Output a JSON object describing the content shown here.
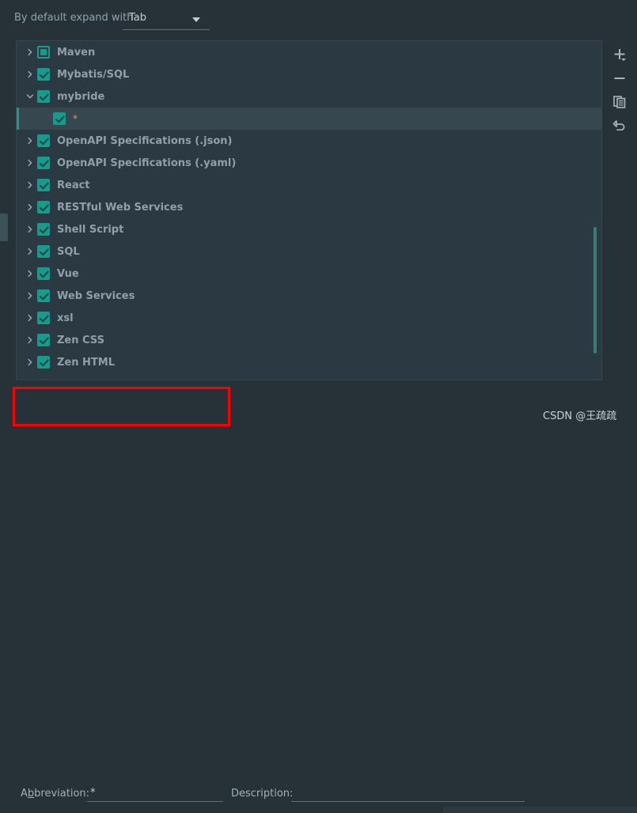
{
  "header": {
    "label": "By default expand with",
    "expand_with": {
      "selected": "Tab",
      "arrow_icon": "chevron-down-icon"
    }
  },
  "tree": {
    "rows": [
      {
        "label": "Maven",
        "checkbox": "partial",
        "twisty": "collapsed",
        "level": 0
      },
      {
        "label": "Mybatis/SQL",
        "checkbox": "checked",
        "twisty": "collapsed",
        "level": 0
      },
      {
        "label": "mybride",
        "checkbox": "checked",
        "twisty": "expanded",
        "level": 0
      },
      {
        "label": "*",
        "checkbox": "checked",
        "twisty": "none",
        "level": 1,
        "selected": true
      },
      {
        "label": "OpenAPI Specifications (.json)",
        "checkbox": "checked",
        "twisty": "collapsed",
        "level": 0
      },
      {
        "label": "OpenAPI Specifications (.yaml)",
        "checkbox": "checked",
        "twisty": "collapsed",
        "level": 0
      },
      {
        "label": "React",
        "checkbox": "checked",
        "twisty": "collapsed",
        "level": 0
      },
      {
        "label": "RESTful Web Services",
        "checkbox": "checked",
        "twisty": "collapsed",
        "level": 0
      },
      {
        "label": "Shell Script",
        "checkbox": "checked",
        "twisty": "collapsed",
        "level": 0
      },
      {
        "label": "SQL",
        "checkbox": "checked",
        "twisty": "collapsed",
        "level": 0
      },
      {
        "label": "Vue",
        "checkbox": "checked",
        "twisty": "collapsed",
        "level": 0
      },
      {
        "label": "Web Services",
        "checkbox": "checked",
        "twisty": "collapsed",
        "level": 0
      },
      {
        "label": "xsl",
        "checkbox": "checked",
        "twisty": "collapsed",
        "level": 0
      },
      {
        "label": "Zen CSS",
        "checkbox": "checked",
        "twisty": "collapsed",
        "level": 0
      },
      {
        "label": "Zen HTML",
        "checkbox": "checked",
        "twisty": "collapsed",
        "level": 0
      }
    ]
  },
  "toolbar": {
    "buttons": [
      {
        "icon": "plus-icon",
        "name": "add-template-button"
      },
      {
        "icon": "minus-icon",
        "name": "remove-template-button"
      },
      {
        "icon": "copy-icon",
        "name": "duplicate-template-button"
      },
      {
        "icon": "revert-icon",
        "name": "revert-template-button"
      }
    ]
  },
  "form": {
    "abbreviation": {
      "label_before": "A",
      "label_mnemonic": "b",
      "label_after": "breviation:",
      "value": "*"
    },
    "description": {
      "label": "Description:",
      "value": ""
    }
  },
  "watermark": {
    "text": "CSDN @王疏疏"
  },
  "colors": {
    "background": "#263238",
    "panel": "#2b3a42",
    "accent_teal": "#169b8e",
    "selection": "#37474f",
    "text": "#90a0a8",
    "annotation_red": "#ff0000",
    "leaf_text": "#c8a06a"
  }
}
